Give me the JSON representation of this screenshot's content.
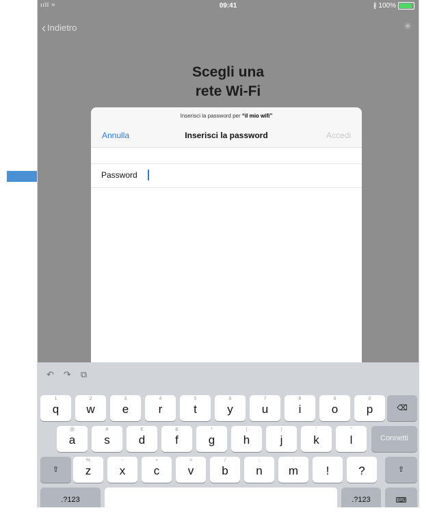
{
  "statusbar": {
    "signal": "ııll ≈",
    "time": "09:41",
    "battery": "∦ 100%",
    "battery_level": 1.0
  },
  "back_label": "Indietro",
  "title_lines": [
    "Scegli una",
    "rete Wi-Fi"
  ],
  "sheet": {
    "prompt_prefix": "Inserisci la password per",
    "network_name": "“il mio wifi”",
    "cancel_label": "Annulla",
    "title": "Inserisci la password",
    "login_label": "Accedi",
    "field_label": "Password"
  },
  "keyboard": {
    "row1": [
      {
        "ch": "q",
        "sub": "1"
      },
      {
        "ch": "w",
        "sub": "2"
      },
      {
        "ch": "e",
        "sub": "3"
      },
      {
        "ch": "r",
        "sub": "4"
      },
      {
        "ch": "t",
        "sub": "5"
      },
      {
        "ch": "y",
        "sub": "6"
      },
      {
        "ch": "u",
        "sub": "7"
      },
      {
        "ch": "i",
        "sub": "8"
      },
      {
        "ch": "o",
        "sub": "9"
      },
      {
        "ch": "p",
        "sub": "0"
      }
    ],
    "row2": [
      {
        "ch": "a",
        "sub": "@"
      },
      {
        "ch": "s",
        "sub": "#"
      },
      {
        "ch": "d",
        "sub": "€"
      },
      {
        "ch": "f",
        "sub": "&"
      },
      {
        "ch": "g",
        "sub": "*"
      },
      {
        "ch": "h",
        "sub": "("
      },
      {
        "ch": "j",
        "sub": ")"
      },
      {
        "ch": "k",
        "sub": "'"
      },
      {
        "ch": "l",
        "sub": "\""
      }
    ],
    "row3": [
      {
        "ch": "z",
        "sub": "%"
      },
      {
        "ch": "x",
        "sub": "-"
      },
      {
        "ch": "c",
        "sub": "+"
      },
      {
        "ch": "v",
        "sub": "="
      },
      {
        "ch": "b",
        "sub": "/"
      },
      {
        "ch": "n",
        "sub": ";"
      },
      {
        "ch": "m",
        "sub": ":"
      },
      {
        "ch": "!",
        "sub": ""
      },
      {
        "ch": "?",
        "sub": ""
      }
    ],
    "connect_label": "Connetti",
    "numbers_label": ".?123"
  }
}
